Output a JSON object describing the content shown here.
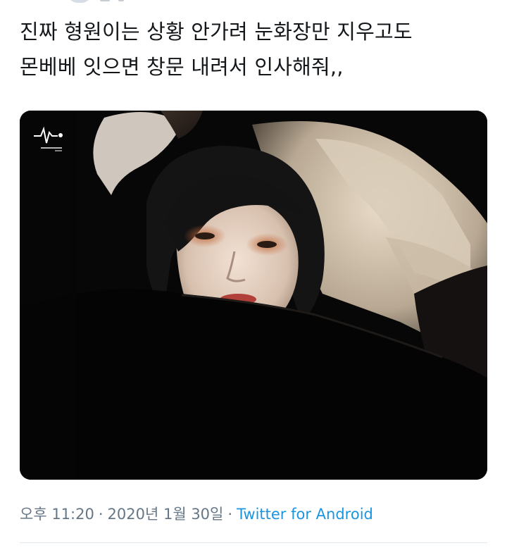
{
  "tweet": {
    "text_line1": "진짜 형원이는 상황 안가려 눈화장만 지우고도",
    "text_line2": "몬베베 잇으면 창문 내려서 인사해줘,,"
  },
  "meta": {
    "time": "오후 11:20",
    "separator": "·",
    "date": "2020년 1월 30일",
    "source": "Twitter for Android"
  },
  "colors": {
    "text": "#14171a",
    "meta": "#657786",
    "link": "#1b95e0"
  },
  "icons": {
    "watermark": "waveform-heart-logo"
  }
}
